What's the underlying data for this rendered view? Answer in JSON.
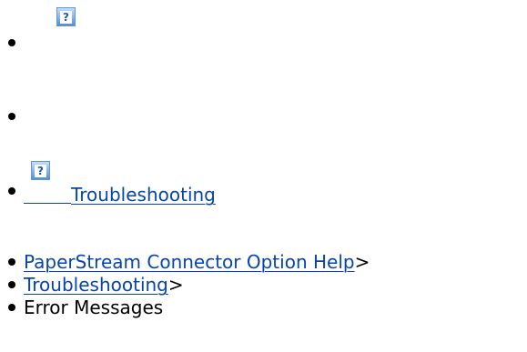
{
  "top_list": {
    "help_icon_name": "help-icon"
  },
  "header_link": {
    "icon_name": "help-icon",
    "label": "Troubleshooting"
  },
  "breadcrumb": {
    "items": [
      {
        "label": "PaperStream Connector Option Help",
        "suffix": ">"
      },
      {
        "label": "Troubleshooting",
        "suffix": ">"
      },
      {
        "label": "Error Messages"
      }
    ]
  },
  "colors": {
    "link": "#0645ad",
    "icon_blue": "#4f8ee0"
  }
}
